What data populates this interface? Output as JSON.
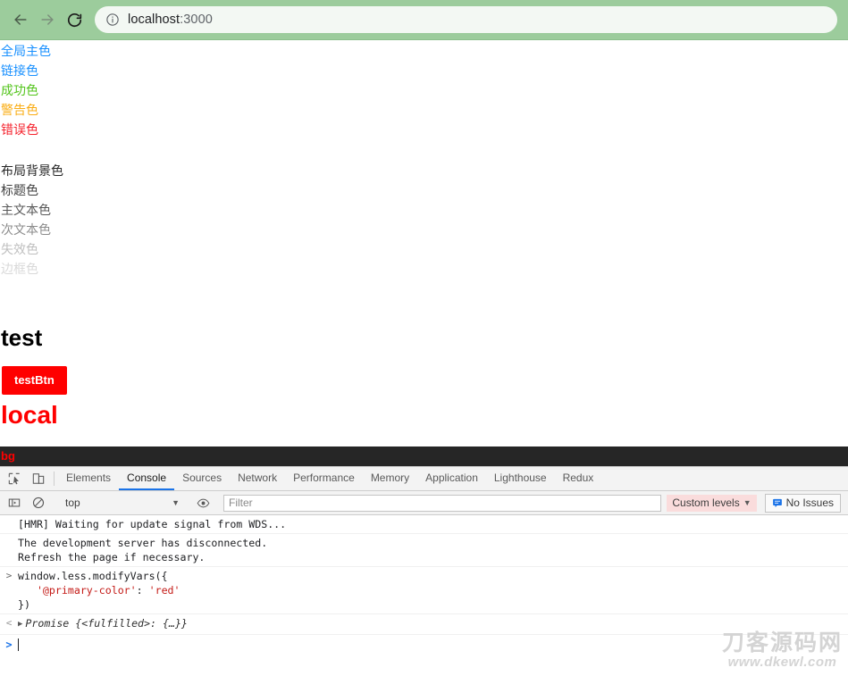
{
  "browser": {
    "back_label": "Back",
    "forward_label": "Forward",
    "reload_label": "Reload",
    "site_info_icon": "info-circle-icon",
    "url_host": "localhost",
    "url_port": ":3000"
  },
  "page": {
    "swatches": [
      {
        "label": "全局主色",
        "color": "#1890ff"
      },
      {
        "label": "链接色",
        "color": "#1890ff"
      },
      {
        "label": "成功色",
        "color": "#52c41a"
      },
      {
        "label": "警告色",
        "color": "#faad14"
      },
      {
        "label": "错误色",
        "color": "#f5222d"
      }
    ],
    "swatches2": [
      {
        "label": "布局背景色",
        "color": "#262626"
      },
      {
        "label": "标题色",
        "color": "#404040"
      },
      {
        "label": "主文本色",
        "color": "#595959"
      },
      {
        "label": "次文本色",
        "color": "#8c8c8c"
      },
      {
        "label": "失效色",
        "color": "#bfbfbf"
      },
      {
        "label": "边框色",
        "color": "#d9d9d9"
      }
    ],
    "heading": "test",
    "button_label": "testBtn",
    "local_label": "local",
    "bg_label": "bg",
    "bg_bar_color": "#262626",
    "accent_red": "#ff0000"
  },
  "watermark": {
    "cn": "刀客源码网",
    "en": "www.dkewl.com"
  },
  "devtools": {
    "inspect_icon": "inspect-element-icon",
    "device_icon": "device-toolbar-icon",
    "tabs": [
      {
        "label": "Elements",
        "active": false
      },
      {
        "label": "Console",
        "active": true
      },
      {
        "label": "Sources",
        "active": false
      },
      {
        "label": "Network",
        "active": false
      },
      {
        "label": "Performance",
        "active": false
      },
      {
        "label": "Memory",
        "active": false
      },
      {
        "label": "Application",
        "active": false
      },
      {
        "label": "Lighthouse",
        "active": false
      },
      {
        "label": "Redux",
        "active": false
      }
    ],
    "sidebar_icon": "console-sidebar-icon",
    "clear_icon": "clear-console-icon",
    "context_value": "top",
    "context_caret": "▼",
    "eye_icon": "live-expression-eye-icon",
    "filter_placeholder": "Filter",
    "filter_value": "",
    "levels_label": "Custom levels",
    "levels_caret": "▼",
    "issues_icon": "issues-bubble-icon",
    "issues_label": "No Issues"
  },
  "console": {
    "messages": [
      {
        "gutter": "",
        "text": "[HMR] Waiting for update signal from WDS...",
        "kind": "log"
      },
      {
        "gutter": "",
        "text": "The development server has disconnected.\nRefresh the page if necessary.",
        "kind": "log"
      }
    ],
    "input_line1": "window.less.modifyVars({",
    "input_str1": "'@primary-color'",
    "input_colon": ": ",
    "input_str2": "'red'",
    "input_line3": "})",
    "input_gutter": ">",
    "result_gutter": "<",
    "result_text": "Promise {<fulfilled>: {…}}",
    "prompt_arrow": ">"
  }
}
